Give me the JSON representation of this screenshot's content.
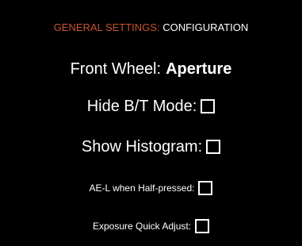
{
  "header": {
    "section": "GENERAL SETTINGS:",
    "page": "CONFIGURATION"
  },
  "colors": {
    "background": "#000000",
    "accent": "#c7542c",
    "text": "#ffffff"
  },
  "settings": [
    {
      "label": "Front Wheel:",
      "value": "Aperture"
    },
    {
      "label": "Hide B/T Mode:",
      "checked": false
    },
    {
      "label": "Show Histogram:",
      "checked": false
    },
    {
      "label": "AE-L when Half-pressed:",
      "checked": false
    },
    {
      "label": "Exposure Quick Adjust:",
      "checked": false
    }
  ]
}
